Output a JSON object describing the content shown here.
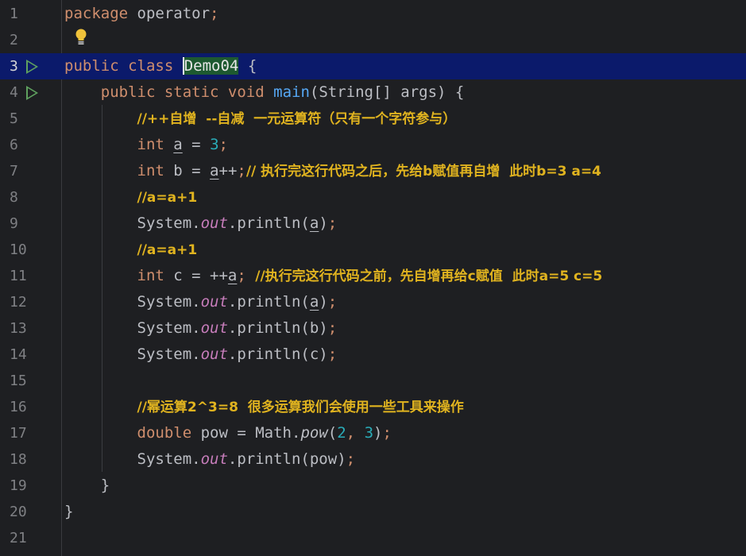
{
  "lines": [
    {
      "n": "1",
      "t": [
        [
          "kw",
          "package "
        ],
        [
          "p",
          "operator"
        ],
        [
          "kw",
          ";"
        ]
      ]
    },
    {
      "n": "2",
      "t": []
    },
    {
      "n": "3",
      "run": true,
      "active": true,
      "t": [
        [
          "kw",
          "public "
        ],
        [
          "kw",
          "class "
        ],
        [
          "clshl",
          "Demo04"
        ],
        [
          "p",
          " {"
        ]
      ]
    },
    {
      "n": "4",
      "run": true,
      "t": [
        [
          "p",
          "    "
        ],
        [
          "kw",
          "public "
        ],
        [
          "kw",
          "static "
        ],
        [
          "kw",
          "void "
        ],
        [
          "fn",
          "main"
        ],
        [
          "p",
          "(String[] args) {"
        ]
      ]
    },
    {
      "n": "5",
      "t": [
        [
          "p",
          "        "
        ],
        [
          "cmt",
          "//++自增  --自减  一元运算符（只有一个字符参与）"
        ]
      ]
    },
    {
      "n": "6",
      "t": [
        [
          "p",
          "        "
        ],
        [
          "kw",
          "int "
        ],
        [
          "ul",
          "a"
        ],
        [
          "p",
          " = "
        ],
        [
          "num",
          "3"
        ],
        [
          "kw",
          ";"
        ]
      ]
    },
    {
      "n": "7",
      "t": [
        [
          "p",
          "        "
        ],
        [
          "kw",
          "int "
        ],
        [
          "p",
          "b = "
        ],
        [
          "ul",
          "a"
        ],
        [
          "p",
          "++"
        ],
        [
          "kw",
          ";"
        ],
        [
          "cmt",
          "// 执行完这行代码之后，先给b赋值再自增  此时b=3 a=4"
        ]
      ]
    },
    {
      "n": "8",
      "t": [
        [
          "p",
          "        "
        ],
        [
          "cmt",
          "//a=a+1"
        ]
      ]
    },
    {
      "n": "9",
      "t": [
        [
          "p",
          "        "
        ],
        [
          "p",
          "System."
        ],
        [
          "fld",
          "out"
        ],
        [
          "p",
          ".println("
        ],
        [
          "ul",
          "a"
        ],
        [
          "p",
          ")"
        ],
        [
          "kw",
          ";"
        ]
      ]
    },
    {
      "n": "10",
      "t": [
        [
          "p",
          "        "
        ],
        [
          "cmt",
          "//a=a+1"
        ]
      ]
    },
    {
      "n": "11",
      "t": [
        [
          "p",
          "        "
        ],
        [
          "kw",
          "int "
        ],
        [
          "p",
          "c = ++"
        ],
        [
          "ul",
          "a"
        ],
        [
          "kw",
          "; "
        ],
        [
          "cmt",
          "//执行完这行代码之前，先自增再给c赋值  此时a=5 c=5"
        ]
      ]
    },
    {
      "n": "12",
      "t": [
        [
          "p",
          "        "
        ],
        [
          "p",
          "System."
        ],
        [
          "fld",
          "out"
        ],
        [
          "p",
          ".println("
        ],
        [
          "ul",
          "a"
        ],
        [
          "p",
          ")"
        ],
        [
          "kw",
          ";"
        ]
      ]
    },
    {
      "n": "13",
      "t": [
        [
          "p",
          "        "
        ],
        [
          "p",
          "System."
        ],
        [
          "fld",
          "out"
        ],
        [
          "p",
          ".println(b)"
        ],
        [
          "kw",
          ";"
        ]
      ]
    },
    {
      "n": "14",
      "t": [
        [
          "p",
          "        "
        ],
        [
          "p",
          "System."
        ],
        [
          "fld",
          "out"
        ],
        [
          "p",
          ".println(c)"
        ],
        [
          "kw",
          ";"
        ]
      ]
    },
    {
      "n": "15",
      "t": []
    },
    {
      "n": "16",
      "t": [
        [
          "p",
          "        "
        ],
        [
          "cmt",
          "//幂运算2^3=8  很多运算我们会使用一些工具来操作"
        ]
      ]
    },
    {
      "n": "17",
      "t": [
        [
          "p",
          "        "
        ],
        [
          "kw",
          "double "
        ],
        [
          "p",
          "pow = Math."
        ],
        [
          "stat",
          "pow"
        ],
        [
          "p",
          "("
        ],
        [
          "num",
          "2"
        ],
        [
          "kw",
          ", "
        ],
        [
          "num",
          "3"
        ],
        [
          "p",
          ")"
        ],
        [
          "kw",
          ";"
        ]
      ]
    },
    {
      "n": "18",
      "t": [
        [
          "p",
          "        "
        ],
        [
          "p",
          "System."
        ],
        [
          "fld",
          "out"
        ],
        [
          "p",
          ".println(pow)"
        ],
        [
          "kw",
          ";"
        ]
      ]
    },
    {
      "n": "19",
      "t": [
        [
          "p",
          "    }"
        ]
      ]
    },
    {
      "n": "20",
      "t": [
        [
          "p",
          "}"
        ]
      ]
    },
    {
      "n": "21",
      "t": []
    }
  ],
  "icons": {
    "run": "run-gutter-icon",
    "bulb": "lightbulb-intention-icon"
  },
  "colors": {
    "background": "#1e1f22",
    "keyword": "#cf8e6d",
    "comment": "#e0b31f",
    "number": "#2aacb8",
    "field": "#c77dbb",
    "active_line": "#0b1a6b"
  }
}
